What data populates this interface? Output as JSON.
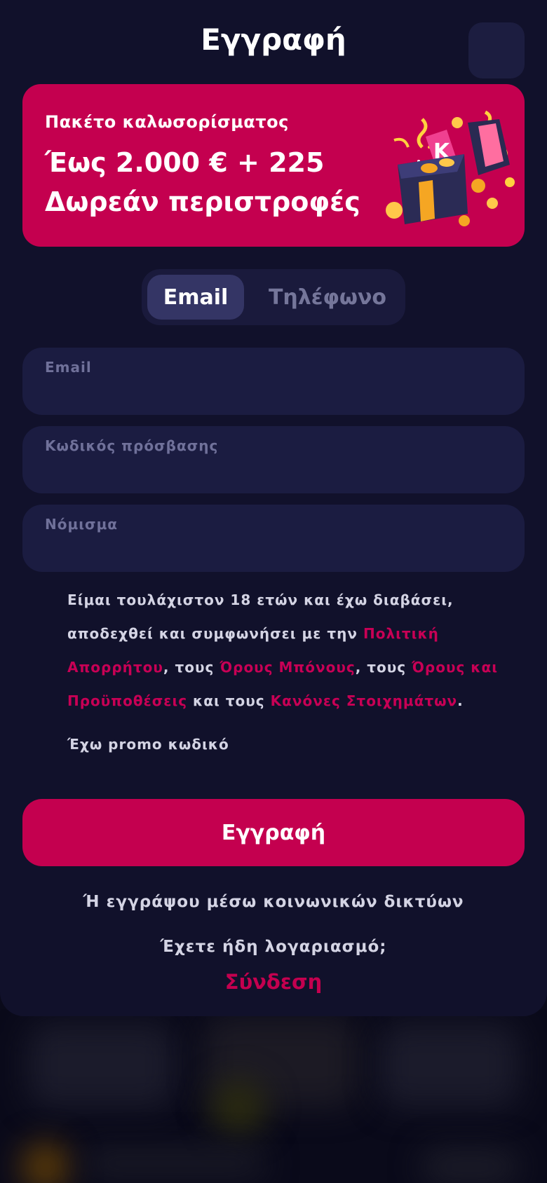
{
  "header": {
    "title": "Εγγραφή"
  },
  "promo": {
    "subtitle": "Πακέτο καλωσορίσματος",
    "headline": "Έως 2.000 € + 225 Δωρεάν περιστροφές"
  },
  "tabs": [
    {
      "label": "Email",
      "active": true
    },
    {
      "label": "Τηλέφωνο",
      "active": false
    }
  ],
  "fields": {
    "email": {
      "label": "Email",
      "value": ""
    },
    "password": {
      "label": "Κωδικός πρόσβασης",
      "value": ""
    },
    "currency": {
      "label": "Νόμισμα",
      "value": ""
    }
  },
  "terms": {
    "part1": "Είμαι τουλάχιστον 18 ετών και έχω διαβάσει, αποδεχθεί και συμφωνήσει με την ",
    "privacy_link": "Πολιτική Απορρήτου",
    "part2": ", τους ",
    "bonus_link": "Όρους Μπόνους",
    "part3": ", τους ",
    "tc_link": "Όρους και Προϋποθέσεις",
    "part4": " και τους ",
    "betting_link": "Κανόνες Στοιχημάτων",
    "part5": "."
  },
  "promo_code_label": "Έχω promo κωδικό",
  "submit_label": "Εγγραφή",
  "social_label": "Ή εγγράψου μέσω κοινωνικών δικτύων",
  "have_account_label": "Έχετε ήδη λογαριασμό;",
  "login_label": "Σύνδεση",
  "colors": {
    "accent": "#c4004f",
    "background": "#11112b",
    "field": "#1b1c41"
  }
}
